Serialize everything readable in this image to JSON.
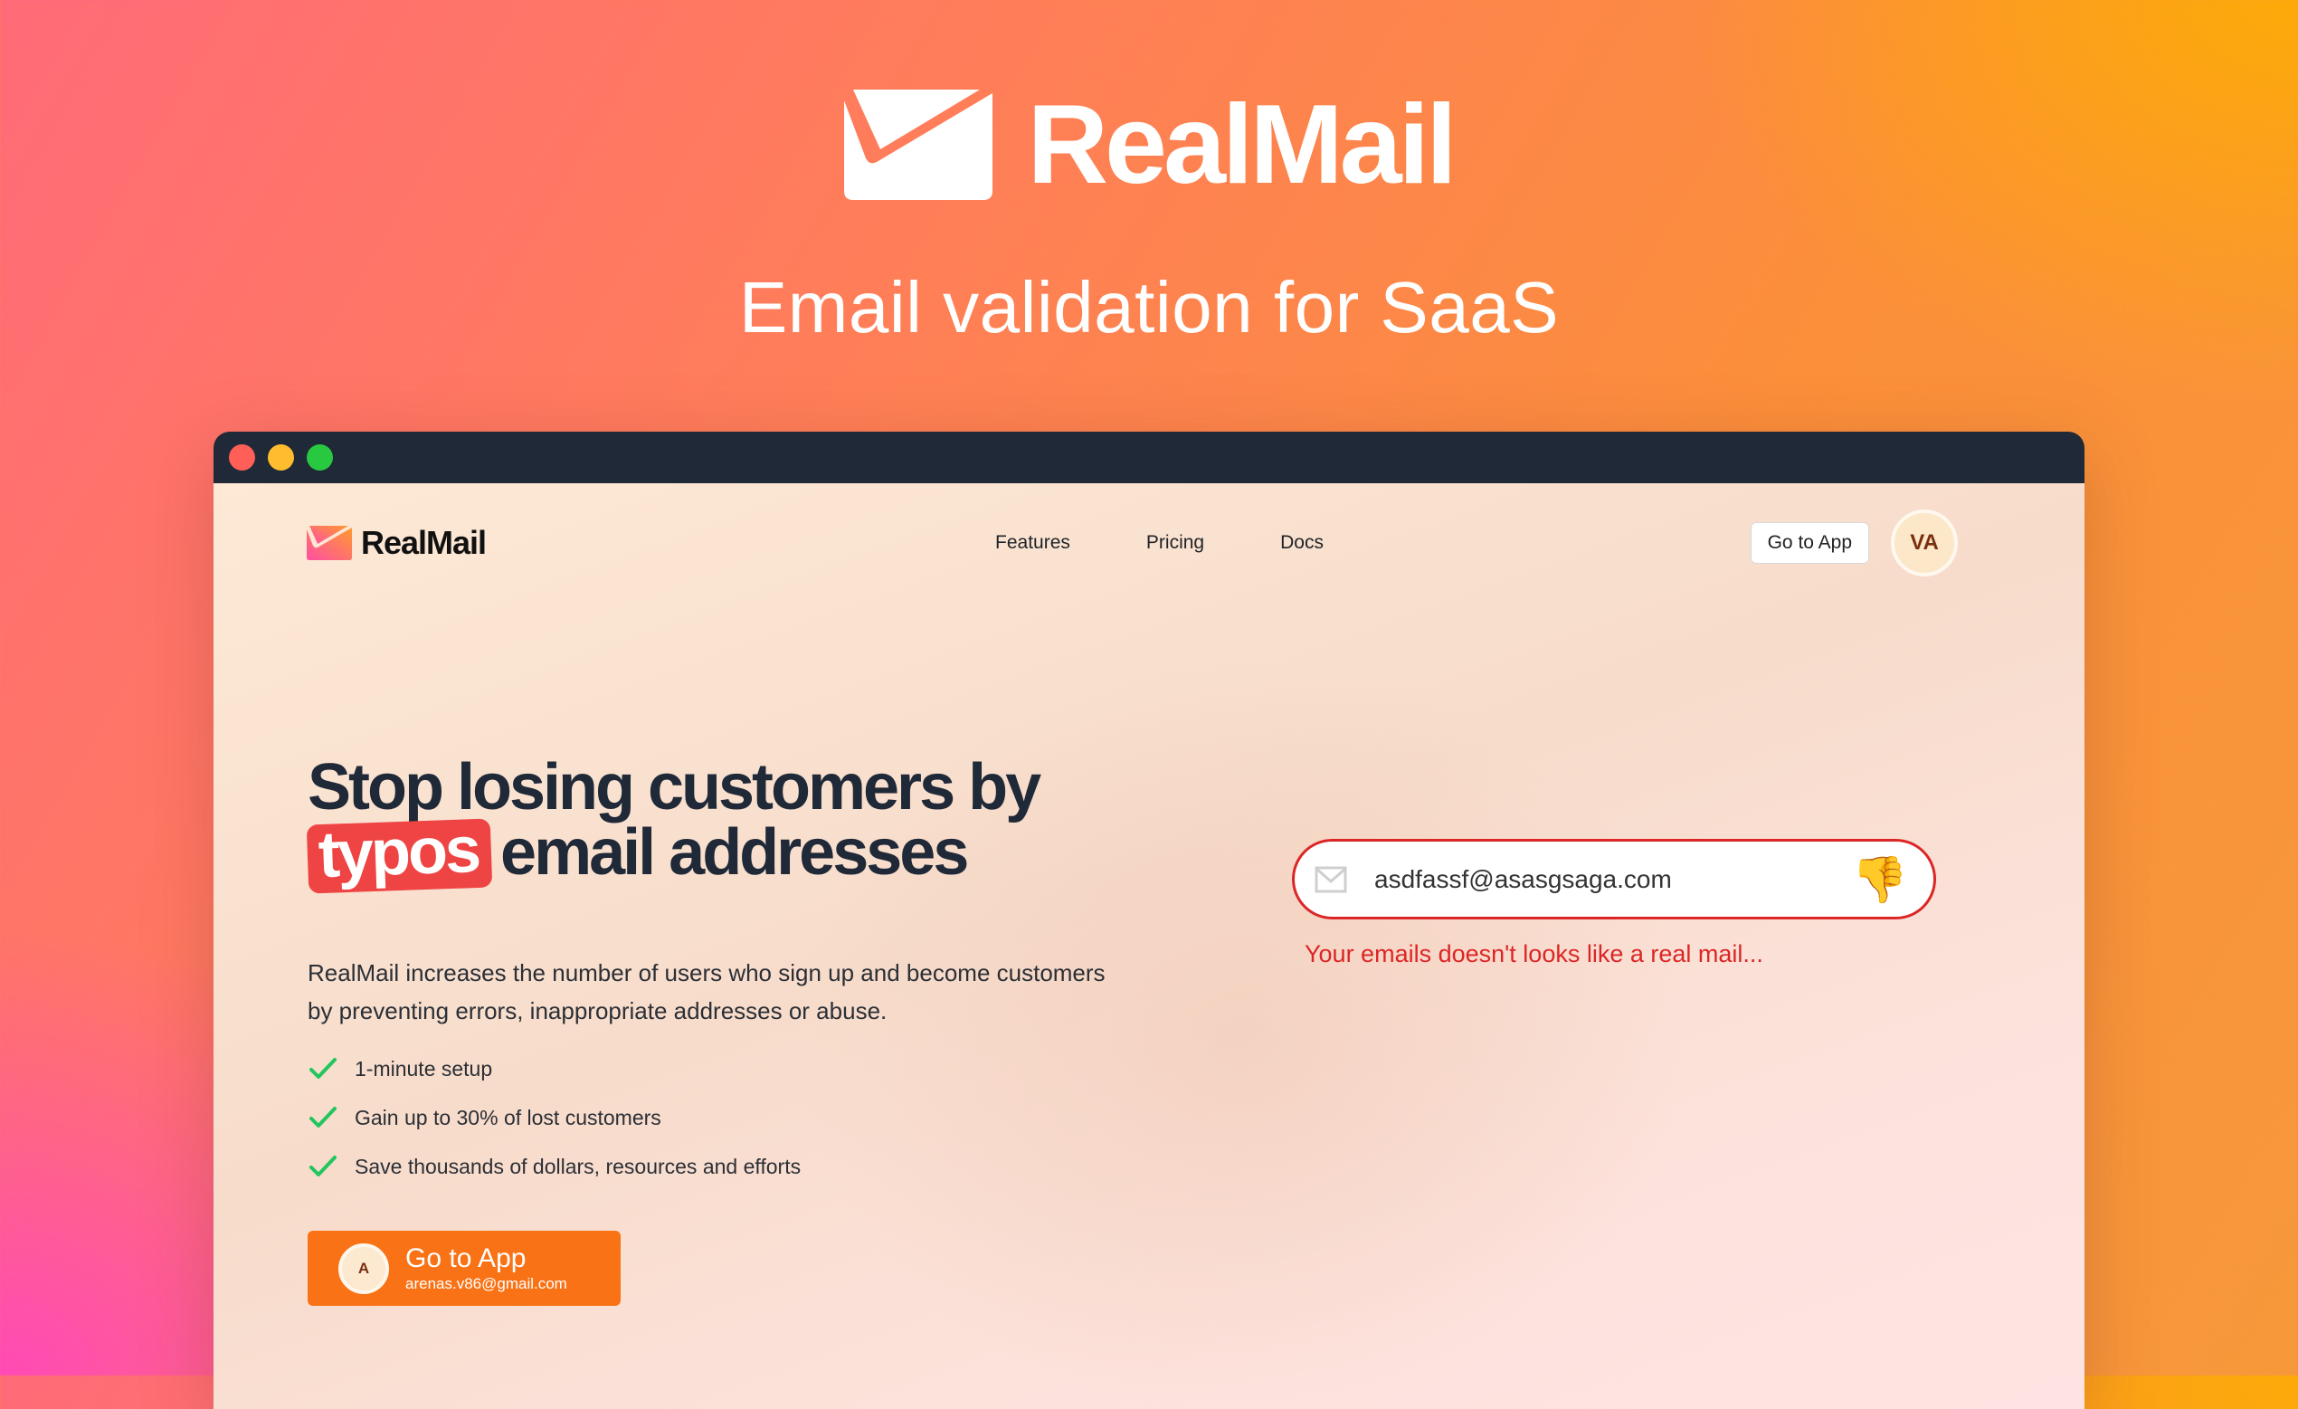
{
  "hero": {
    "brand_name": "RealMail",
    "tagline": "Email validation for SaaS"
  },
  "window": {
    "controls": [
      "close",
      "minimize",
      "maximize"
    ]
  },
  "nav": {
    "brand_name": "RealMail",
    "links": [
      {
        "label": "Features"
      },
      {
        "label": "Pricing"
      },
      {
        "label": "Docs"
      }
    ],
    "go_to_app_label": "Go to App",
    "avatar_initials": "VA"
  },
  "main": {
    "headline_line1": "Stop losing customers by",
    "headline_highlight": "typos",
    "headline_line2_rest": "email addresses",
    "description": "RealMail increases the number of users who sign up and become customers by preventing errors, inappropriate addresses or abuse.",
    "features": [
      {
        "label": "1-minute setup"
      },
      {
        "label": "Gain up to 30% of lost customers"
      },
      {
        "label": "Save thousands of dollars, resources and efforts"
      }
    ],
    "cta": {
      "label": "Go to App",
      "email": "arenas.v86@gmail.com",
      "avatar_initial": "A"
    }
  },
  "validator": {
    "email_value": "asdfassf@asasgsaga.com",
    "status_emoji": "👎",
    "error_message": "Your emails doesn't looks like a real mail..."
  },
  "colors": {
    "accent_orange": "#f97316",
    "error_red": "#dc2626",
    "highlight_red": "#ef4444",
    "check_green": "#22c55e",
    "titlebar": "#1f2937"
  }
}
